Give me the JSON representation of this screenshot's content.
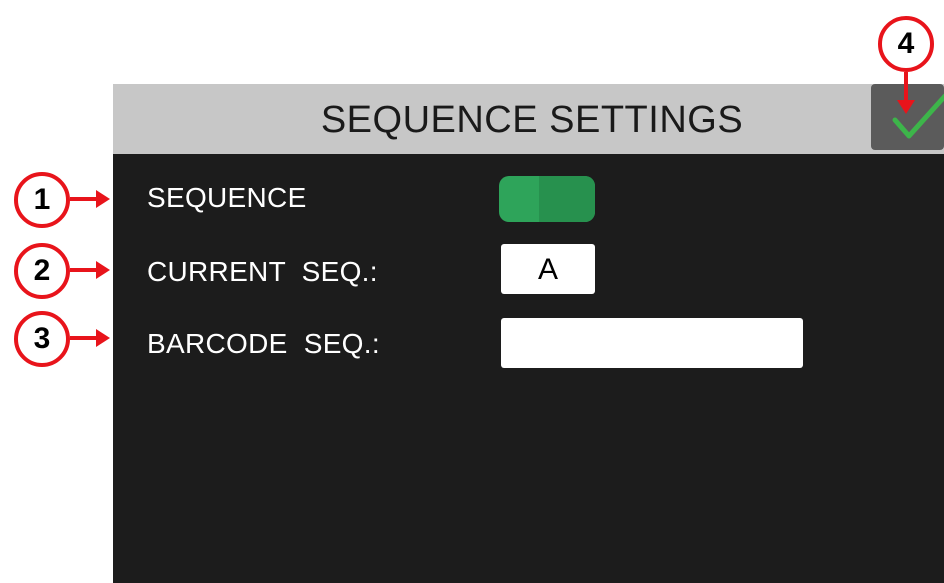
{
  "screen": {
    "title": "SEQUENCE SETTINGS",
    "confirm_icon": "check-icon"
  },
  "settings": {
    "sequence_label": "SEQUENCE",
    "sequence_toggle_on": true,
    "current_seq_label": "CURRENT  SEQ.:",
    "current_seq_value": "A",
    "barcode_seq_label": "BARCODE  SEQ.:",
    "barcode_seq_value": ""
  },
  "callouts": [
    "1",
    "2",
    "3",
    "4"
  ],
  "colors": {
    "screen_bg": "#1c1c1c",
    "titlebar_bg": "#c7c7c7",
    "toggle_green": "#2ea45a",
    "check_green": "#3db54a",
    "callout_red": "#e8141b"
  }
}
